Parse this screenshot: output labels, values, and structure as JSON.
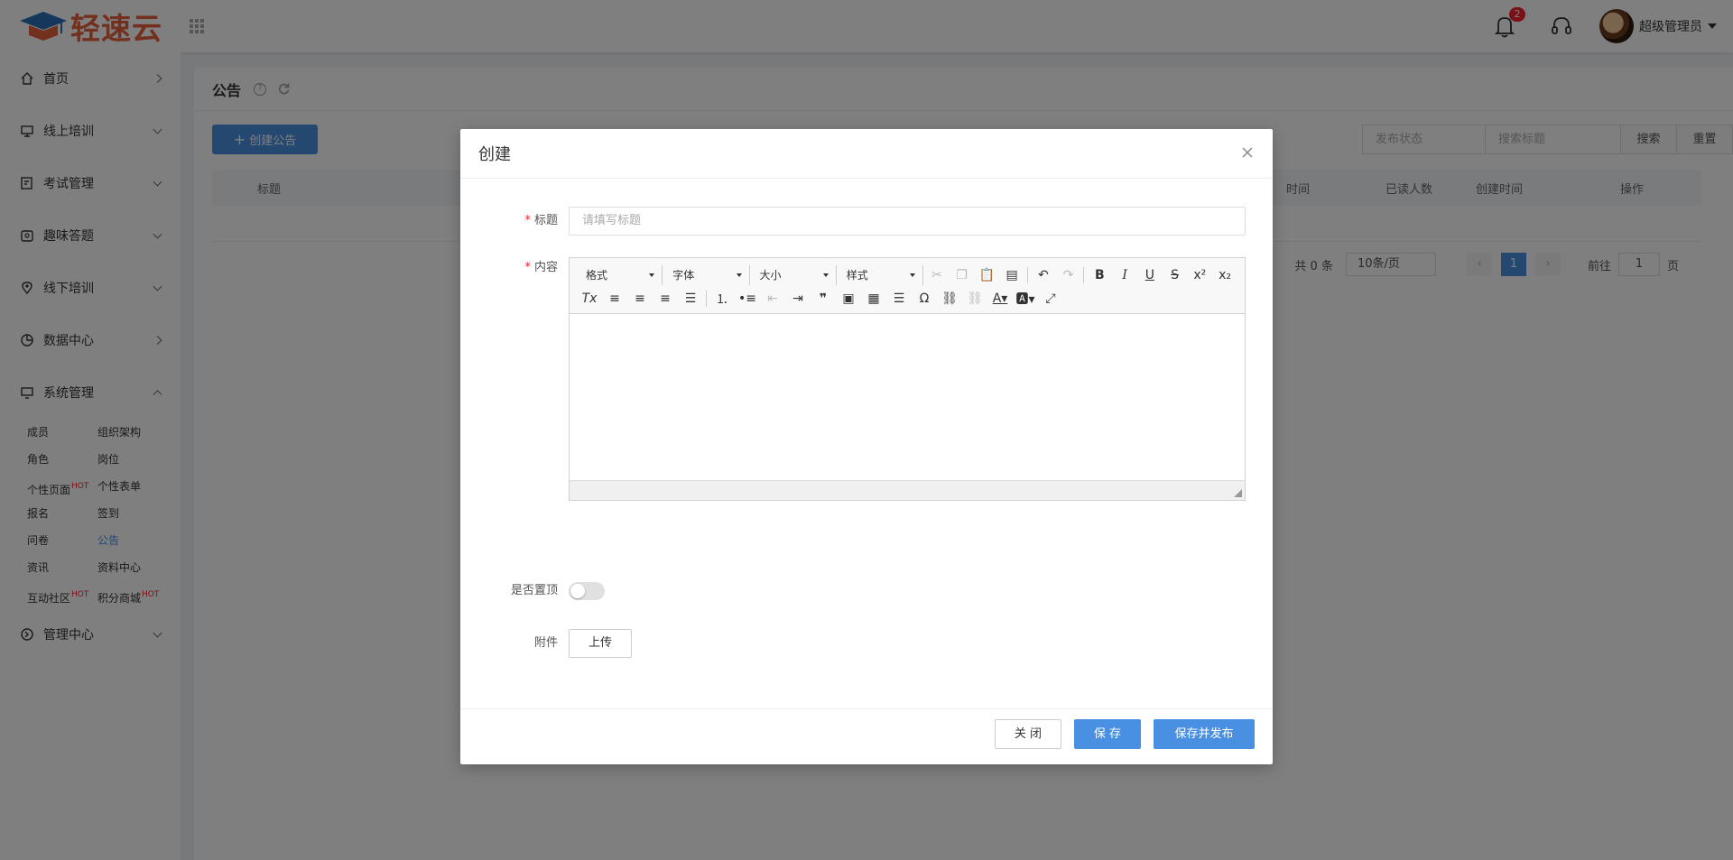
{
  "header": {
    "logo_text": "轻速云",
    "notification_count": "2",
    "username": "超级管理员"
  },
  "sidebar": {
    "items": [
      {
        "label": "首页"
      },
      {
        "label": "线上培训"
      },
      {
        "label": "考试管理"
      },
      {
        "label": "趣味答题"
      },
      {
        "label": "线下培训"
      },
      {
        "label": "数据中心"
      },
      {
        "label": "系统管理"
      },
      {
        "label": "管理中心"
      }
    ],
    "submenu": [
      {
        "label": "成员"
      },
      {
        "label": "组织架构"
      },
      {
        "label": "角色"
      },
      {
        "label": "岗位"
      },
      {
        "label": "个性页面",
        "hot": "HOT"
      },
      {
        "label": "个性表单"
      },
      {
        "label": "报名"
      },
      {
        "label": "签到"
      },
      {
        "label": "问卷"
      },
      {
        "label": "公告"
      },
      {
        "label": "资讯"
      },
      {
        "label": "资料中心"
      },
      {
        "label": "互动社区",
        "hot": "HOT"
      },
      {
        "label": "积分商城",
        "hot": "HOT"
      }
    ]
  },
  "page": {
    "title": "公告",
    "create_button": "创建公告",
    "filter_status_placeholder": "发布状态",
    "search_placeholder": "搜索标题",
    "search_button": "搜索",
    "reset_button": "重置",
    "columns": {
      "title": "标题",
      "time": "时间",
      "read_count": "已读人数",
      "created_at": "创建时间",
      "actions": "操作"
    },
    "pagination": {
      "total": "共 0 条",
      "page_size": "10条/页",
      "current_page": "1",
      "goto_prefix": "前往",
      "goto_value": "1",
      "goto_suffix": "页"
    }
  },
  "modal": {
    "title": "创建",
    "title_label": "标题",
    "title_placeholder": "请填写标题",
    "content_label": "内容",
    "toolbar": {
      "format": "格式",
      "font": "字体",
      "size": "大小",
      "style": "样式"
    },
    "pin_label": "是否置顶",
    "attachment_label": "附件",
    "upload_button": "上传",
    "close_button": "关 闭",
    "save_button": "保 存",
    "save_publish_button": "保存并发布"
  },
  "colors": {
    "primary": "#4a90e2",
    "brand": "#e8603c",
    "hot": "#f5222d"
  }
}
